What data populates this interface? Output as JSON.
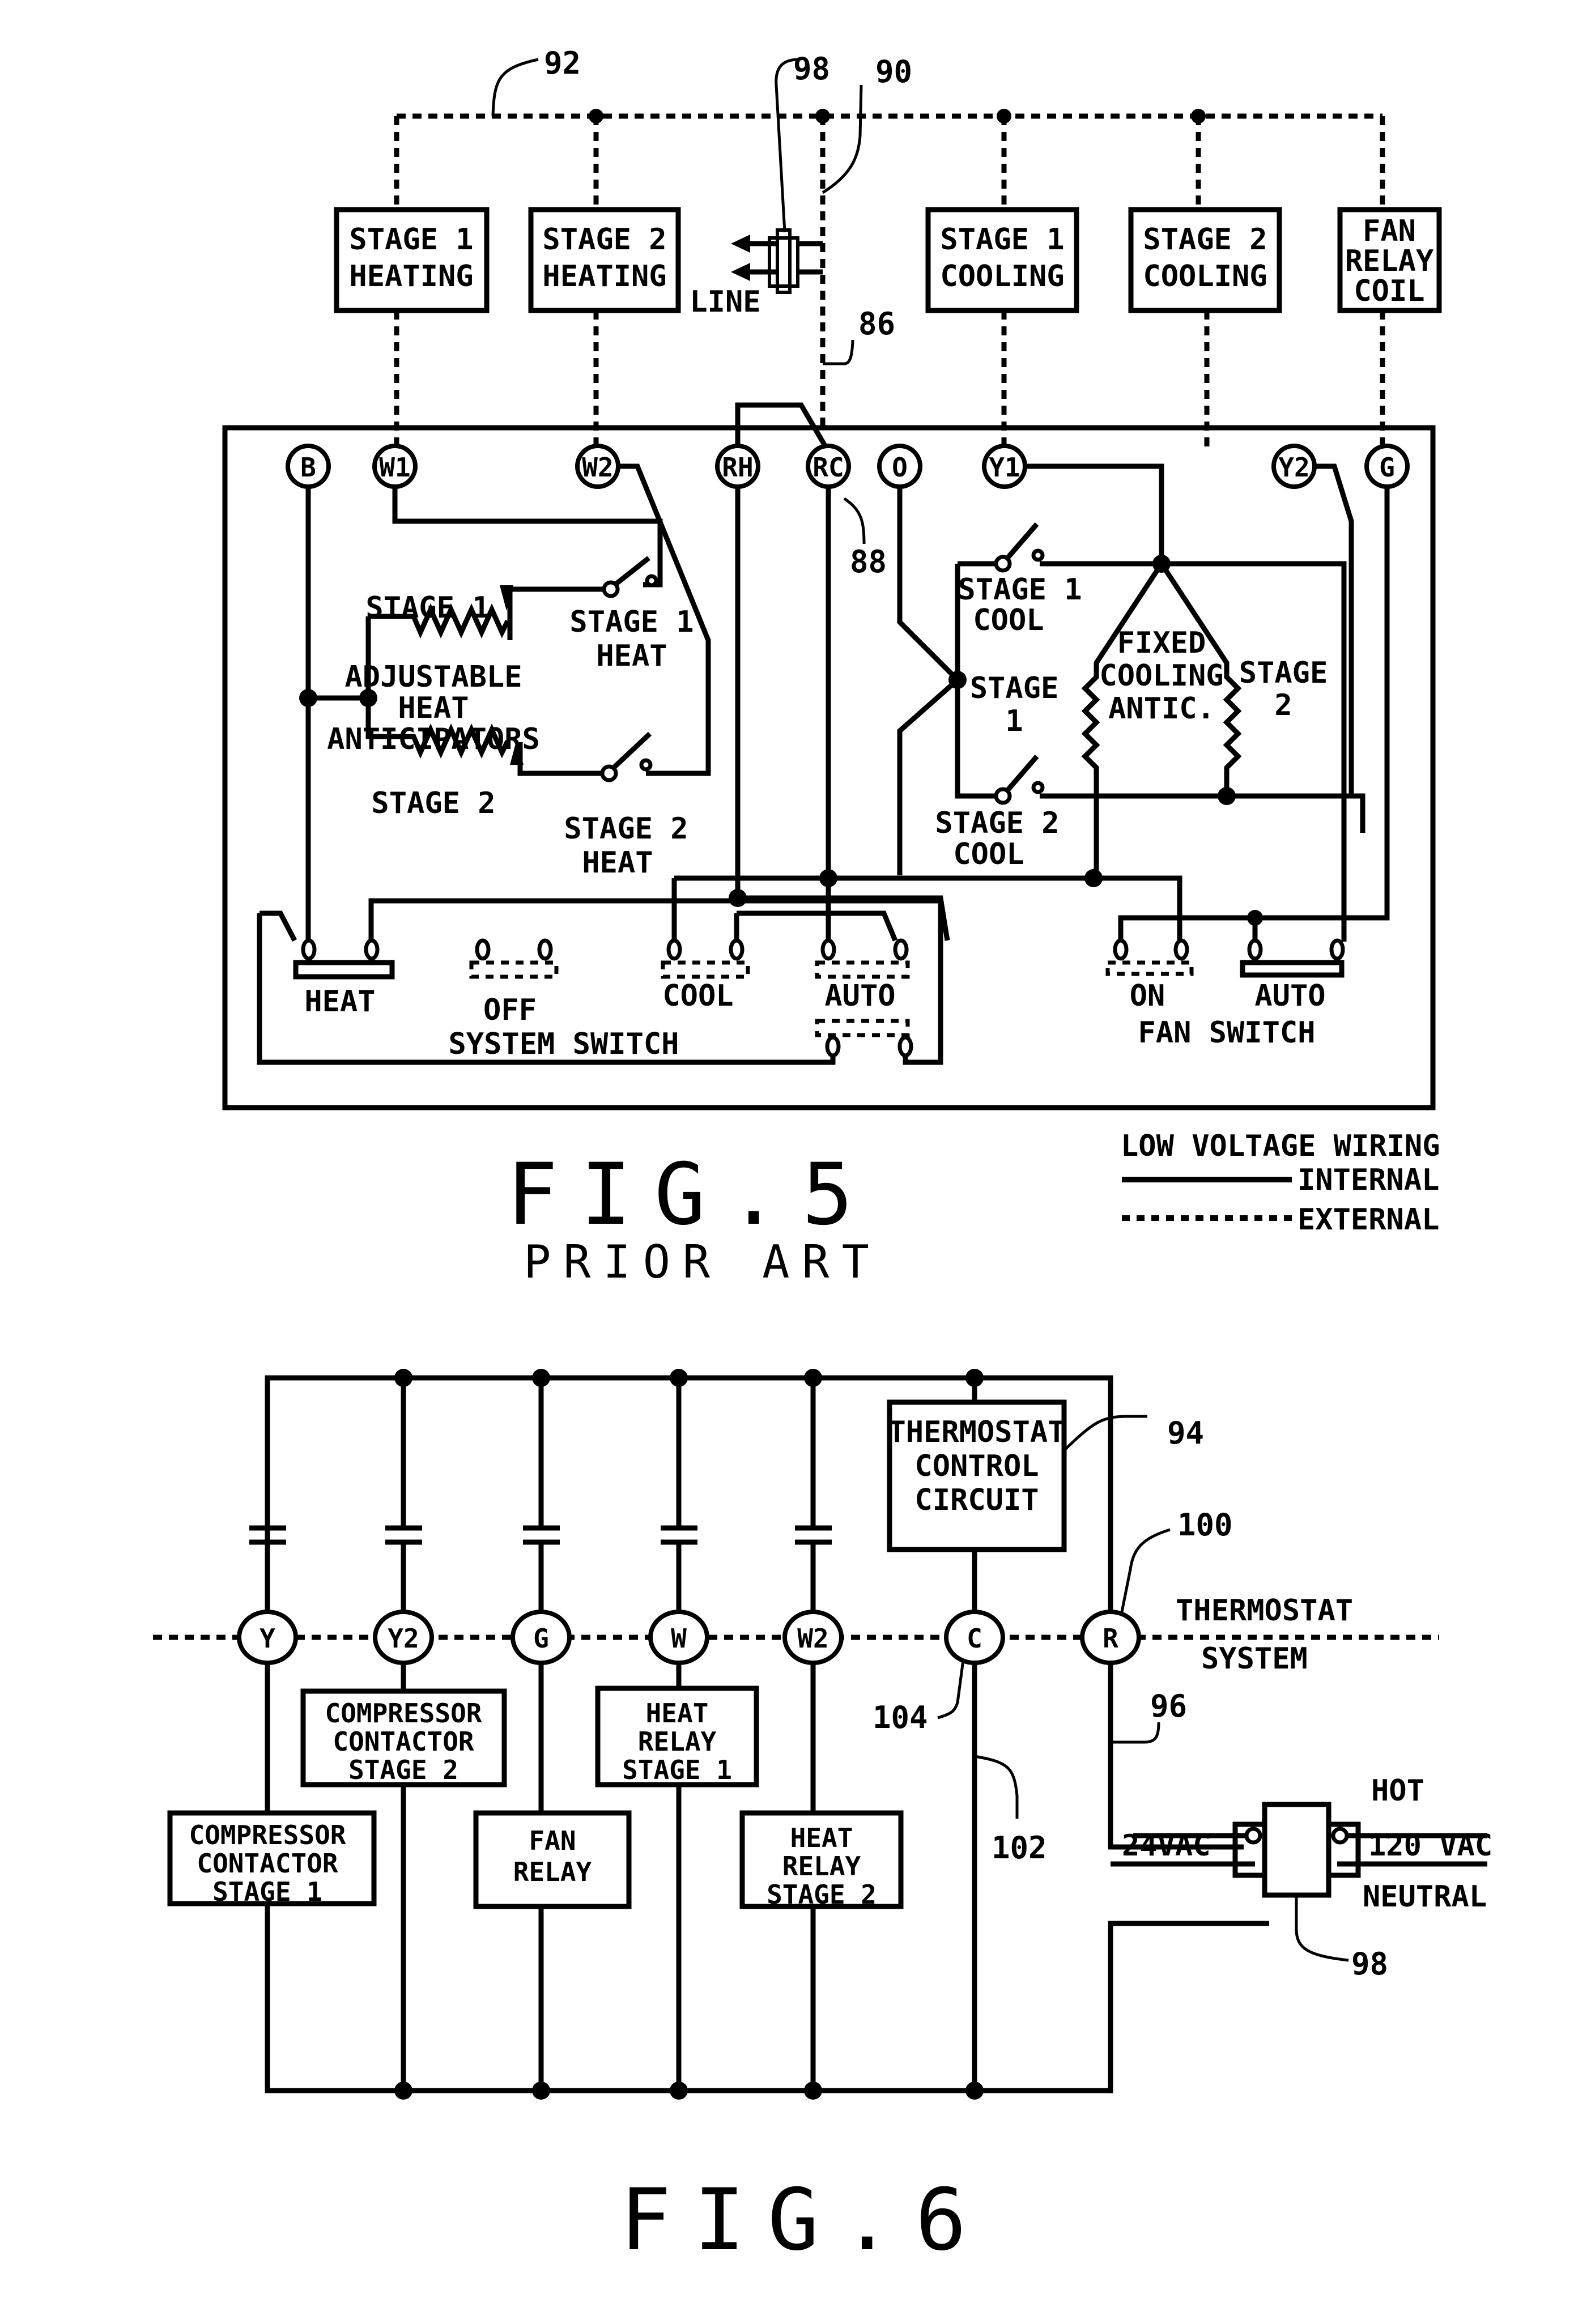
{
  "fig5": {
    "caption": "FIG.5",
    "subcaption": "PRIOR ART",
    "refs": {
      "bus": "92",
      "transformer": "98",
      "line_wire": "90",
      "rc_wire": "86",
      "jumper": "88"
    },
    "line_label": "LINE",
    "loads": [
      {
        "lines": [
          "STAGE 1",
          "HEATING"
        ]
      },
      {
        "lines": [
          "STAGE 2",
          "HEATING"
        ]
      },
      {
        "lines": [
          "STAGE 1",
          "COOLING"
        ]
      },
      {
        "lines": [
          "STAGE 2",
          "COOLING"
        ]
      },
      {
        "lines": [
          "FAN",
          "RELAY",
          "COIL"
        ]
      }
    ],
    "terminals": [
      "B",
      "W1",
      "W2",
      "RH",
      "RC",
      "O",
      "Y1",
      "Y2",
      "G"
    ],
    "heat_section": {
      "stage1_anticipator": "STAGE 1",
      "anticipators": [
        "ADJUSTABLE",
        "HEAT",
        "ANTICIPATORS"
      ],
      "stage2_anticipator": "STAGE 2",
      "stage1_switch": [
        "STAGE 1",
        "HEAT"
      ],
      "stage2_switch": [
        "STAGE 2",
        "HEAT"
      ]
    },
    "cool_section": {
      "stage1_switch": [
        "STAGE 1",
        "COOL"
      ],
      "stage2_switch": [
        "STAGE 2",
        "COOL"
      ],
      "stage1_antic": [
        "STAGE",
        "1"
      ],
      "fixed_antic": [
        "FIXED",
        "COOLING",
        "ANTIC."
      ],
      "stage2_antic": [
        "STAGE",
        "2"
      ]
    },
    "system_switch": {
      "title": "SYSTEM SWITCH",
      "positions": [
        "HEAT",
        "OFF",
        "COOL",
        "AUTO"
      ],
      "selected": "HEAT"
    },
    "fan_switch": {
      "title": "FAN SWITCH",
      "positions": [
        "ON",
        "AUTO"
      ],
      "selected": "AUTO"
    },
    "legend": {
      "title": "LOW VOLTAGE WIRING",
      "internal": "INTERNAL",
      "external": "EXTERNAL"
    }
  },
  "fig6": {
    "caption": "FIG.6",
    "refs": {
      "control": "94",
      "r_terminal": "100",
      "c_terminal": "104",
      "r_wire": "96",
      "c_wire": "102",
      "transformer": "98"
    },
    "terminals": [
      "Y",
      "Y2",
      "G",
      "W",
      "W2",
      "C",
      "R"
    ],
    "control_box": [
      "THERMOSTAT",
      "CONTROL",
      "CIRCUIT"
    ],
    "boundary": {
      "upper": "THERMOSTAT",
      "lower": "SYSTEM"
    },
    "loads": [
      {
        "lines": [
          "COMPRESSOR",
          "CONTACTOR",
          "STAGE 1"
        ]
      },
      {
        "lines": [
          "COMPRESSOR",
          "CONTACTOR",
          "STAGE 2"
        ]
      },
      {
        "lines": [
          "FAN",
          "RELAY"
        ]
      },
      {
        "lines": [
          "HEAT",
          "RELAY",
          "STAGE 1"
        ]
      },
      {
        "lines": [
          "HEAT",
          "RELAY",
          "STAGE 2"
        ]
      }
    ],
    "transformer": {
      "secondary": "24VAC",
      "primary": "120 VAC",
      "hot": "HOT",
      "neutral": "NEUTRAL"
    }
  }
}
